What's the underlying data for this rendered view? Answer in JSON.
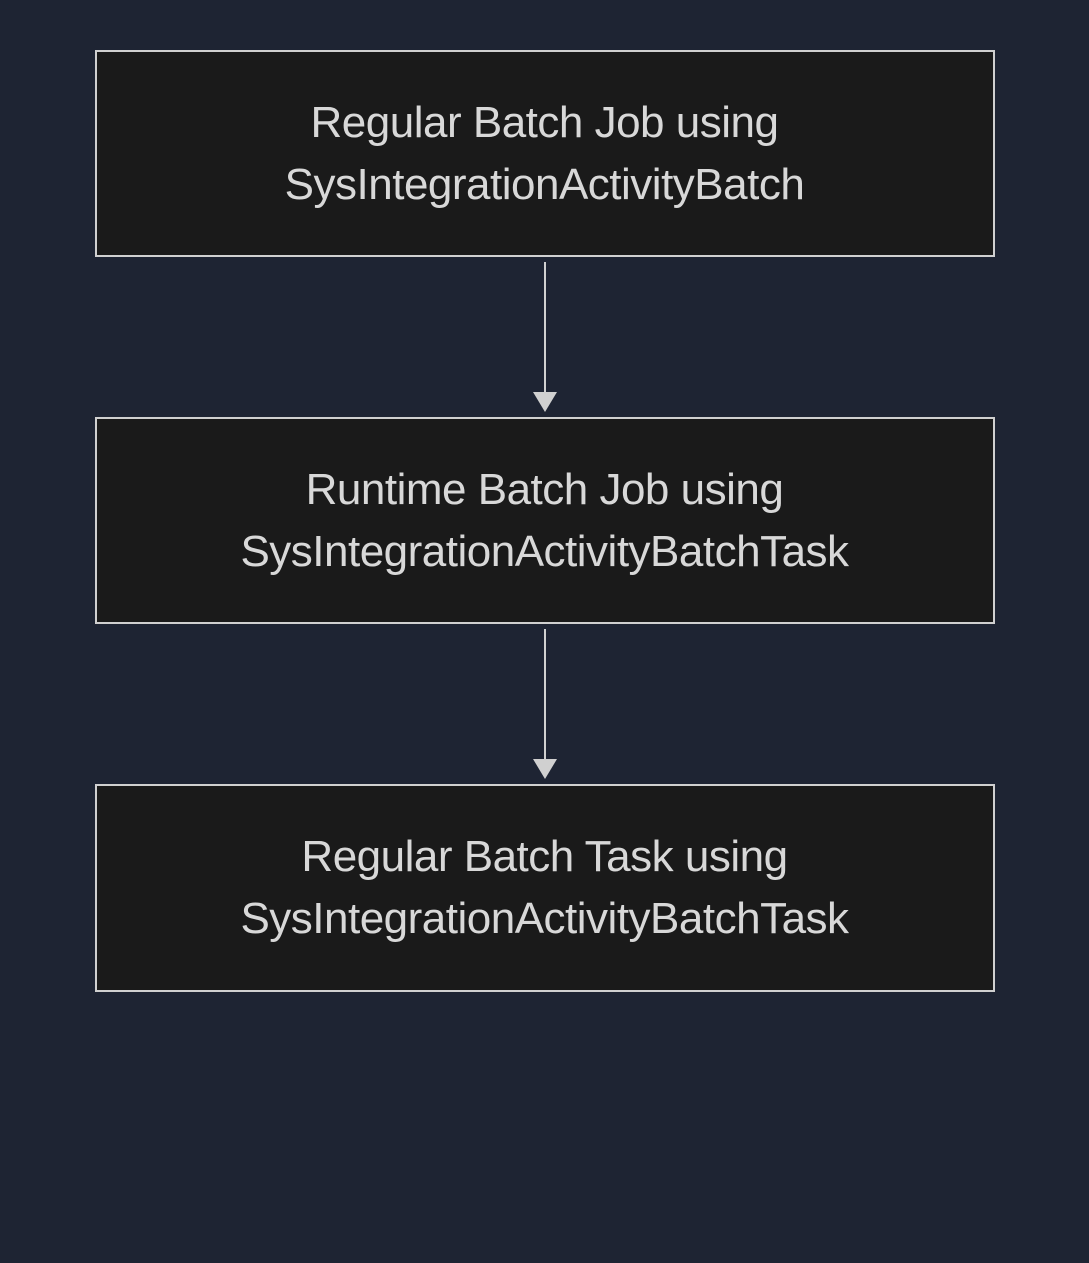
{
  "diagram": {
    "nodes": [
      {
        "line1": "Regular Batch Job using",
        "line2": "SysIntegrationActivityBatch"
      },
      {
        "line1": "Runtime Batch Job using",
        "line2": "SysIntegrationActivityBatchTask"
      },
      {
        "line1": "Regular Batch Task using",
        "line2": "SysIntegrationActivityBatchTask"
      }
    ]
  }
}
